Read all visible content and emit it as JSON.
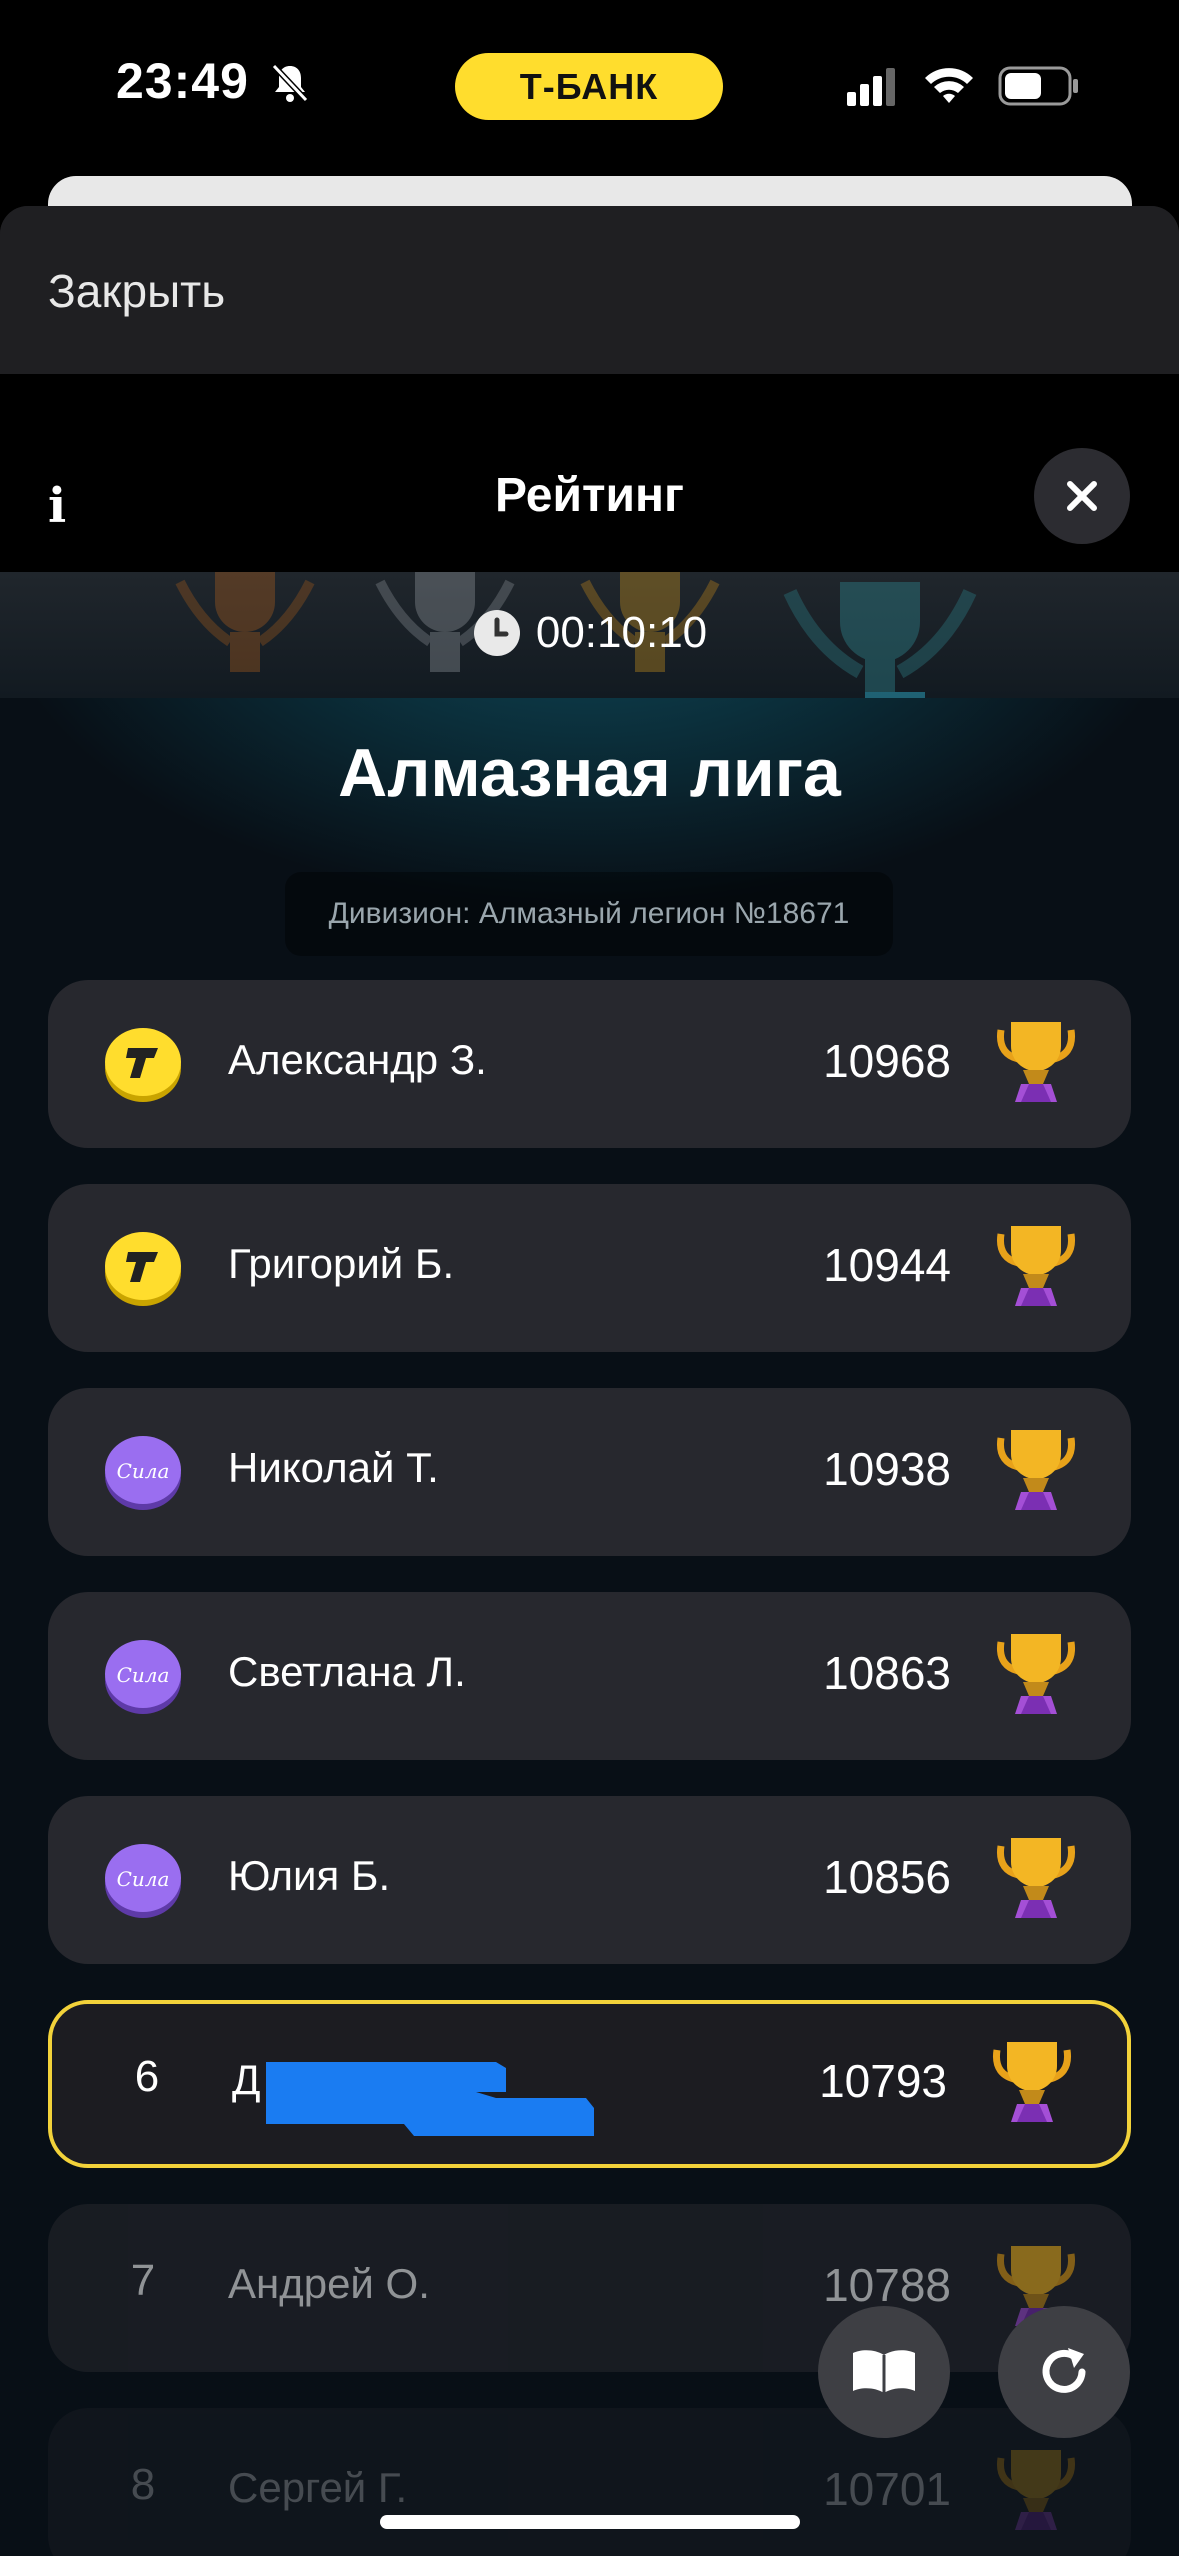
{
  "status_bar": {
    "time": "23:49",
    "carrier": "Т-БАНК"
  },
  "sheet": {
    "close_label": "Закрыть"
  },
  "header": {
    "title": "Рейтинг"
  },
  "banner": {
    "timer": "00:10:10"
  },
  "league": {
    "name": "Алмазная лига",
    "division": "Дивизион: Алмазный легион №18671"
  },
  "leaderboard": [
    {
      "badge": "Т",
      "badge_type": "tbank",
      "name": "Александр З.",
      "score": "10968"
    },
    {
      "badge": "Т",
      "badge_type": "tbank",
      "name": "Григорий Б.",
      "score": "10944"
    },
    {
      "badge": "Сила",
      "badge_type": "purple",
      "name": "Николай Т.",
      "score": "10938"
    },
    {
      "badge": "Сила",
      "badge_type": "purple",
      "name": "Светлана Л.",
      "score": "10863"
    },
    {
      "badge": "Сила",
      "badge_type": "purple",
      "name": "Юлия Б.",
      "score": "10856"
    },
    {
      "rank": "6",
      "name": "Д",
      "score": "10793",
      "current_user": true
    },
    {
      "rank": "7",
      "name": "Андрей О.",
      "score": "10788"
    },
    {
      "rank": "8",
      "name": "Сергей Г.",
      "score": "10701"
    }
  ],
  "colors": {
    "accent": "#ffdd2d",
    "highlight_border": "#f2d23a",
    "purple_badge": "#8e63e6",
    "row_bg": "#27282e"
  }
}
